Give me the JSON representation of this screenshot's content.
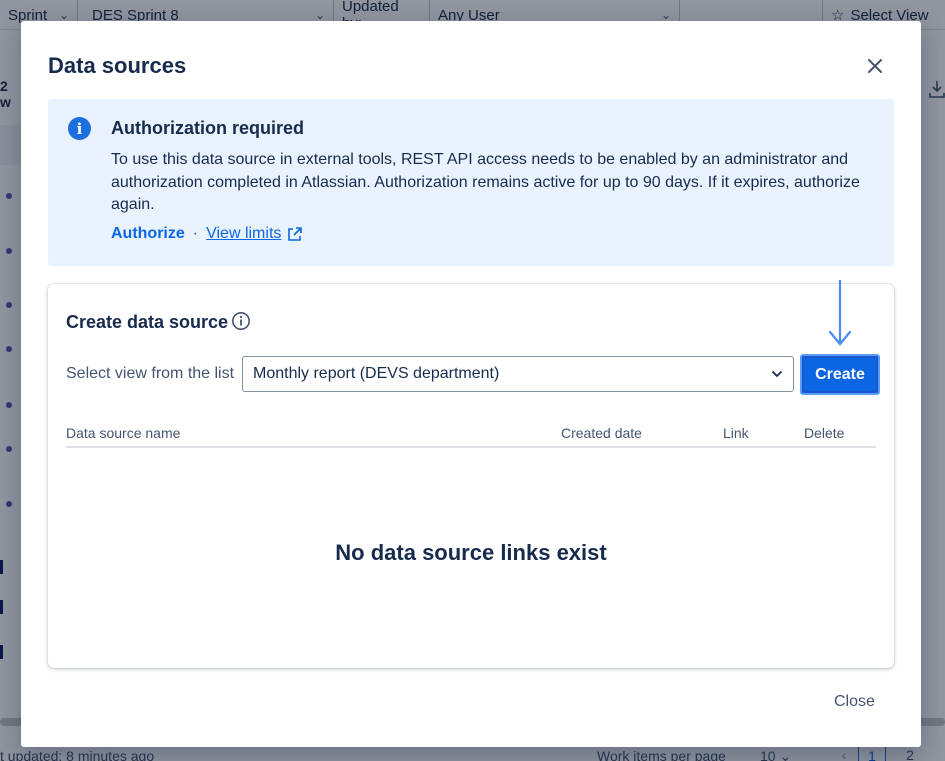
{
  "background": {
    "toolbar": {
      "sprint_label": "Sprint",
      "sprint_value": "DES Sprint 8",
      "updated_by_label": "Updated by:",
      "updated_by_value": "Any User",
      "select_view": "Select View"
    },
    "left_fragment": "2 w",
    "bottom": {
      "last_updated": "t updated: 8 minutes ago",
      "work_items_per_page": "Work items per page",
      "per_page_value": "10",
      "page_1": "1",
      "page_2": "2"
    }
  },
  "modal": {
    "title": "Data sources",
    "close_icon": "close-icon",
    "banner": {
      "heading": "Authorization required",
      "text": "To use this data source in external tools, REST API access needs to be enabled by an administrator and authorization completed in Atlassian. Authorization remains active for up to 90 days. If it expires, authorize again.",
      "authorize_link": "Authorize",
      "separator": "·",
      "view_limits_link": "View limits",
      "info_icon": "info-icon",
      "external_icon": "external-link-icon",
      "color": "#e9f2ff"
    },
    "create_card": {
      "title": "Create data source",
      "select_label": "Select view from the list",
      "selected_view": "Monthly report (DEVS department)",
      "create_button": "Create",
      "columns": [
        "Data source name",
        "Created date",
        "Link",
        "Delete"
      ],
      "empty_message": "No data source links exist"
    },
    "footer_close": "Close"
  },
  "colors": {
    "primary": "#0c66e4",
    "arrow": "#4c8bf5"
  }
}
